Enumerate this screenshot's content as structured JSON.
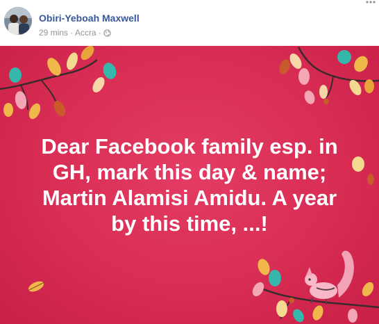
{
  "post": {
    "author": "Obiri-Yeboah Maxwell",
    "time": "29 mins",
    "separator": "·",
    "location": "Accra",
    "privacy_icon": "globe-icon",
    "message": "Dear Facebook family esp. in\nGH, mark this day & name;\nMartin Alamisi Amidu. A year\nby this time, ...!"
  },
  "colors": {
    "author_link": "#365899",
    "meta_text": "#90949c",
    "banner_background": "#d82d54",
    "message_text": "#ffffff"
  }
}
